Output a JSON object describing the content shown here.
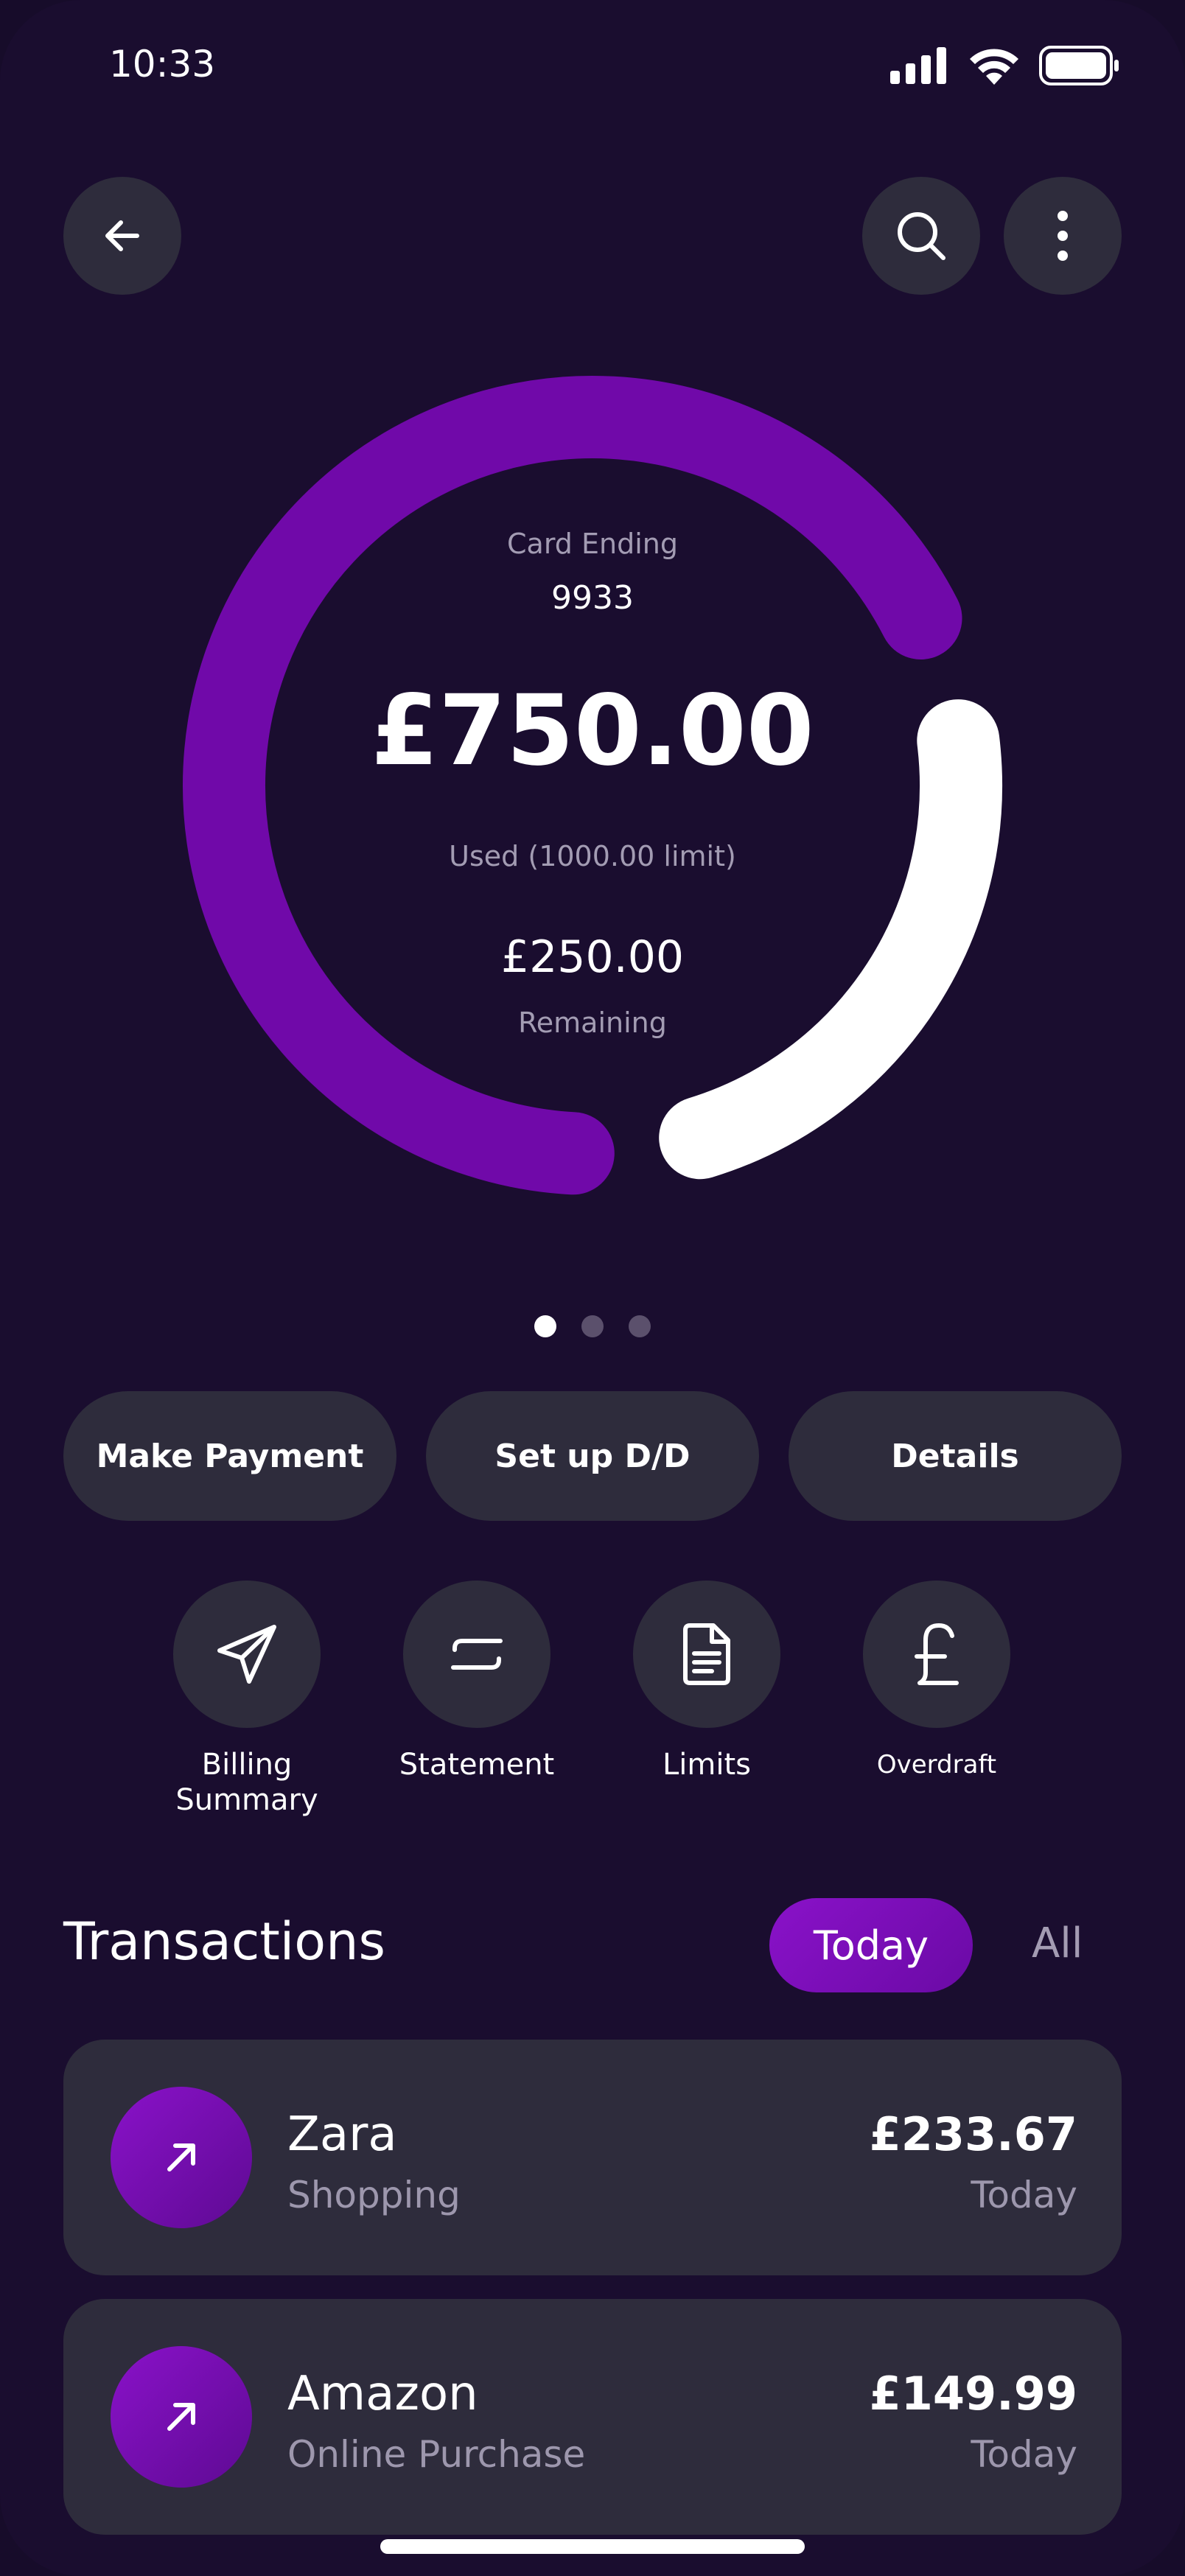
{
  "status_bar": {
    "time": "10:33"
  },
  "card": {
    "ending_label": "Card Ending",
    "ending_number": "9933",
    "used_amount": "£750.00",
    "used_label": "Used (1000.00 limit)",
    "remaining_amount": "£250.00",
    "remaining_label": "Remaining",
    "used_fraction": 0.75,
    "colors": {
      "used": "#7009a9",
      "remaining": "#ffffff"
    }
  },
  "pager": {
    "pages": 3,
    "active": 0
  },
  "actions": {
    "make_payment": "Make Payment",
    "setup_dd": "Set up D/D",
    "details": "Details"
  },
  "quick_actions": [
    {
      "label": "Billing\nSummary",
      "icon": "send-icon"
    },
    {
      "label": "Statement",
      "icon": "statement-icon"
    },
    {
      "label": "Limits",
      "icon": "document-icon"
    },
    {
      "label": "Overdraft",
      "icon": "pound-icon"
    }
  ],
  "transactions": {
    "title": "Transactions",
    "tabs": {
      "today": "Today",
      "all": "All"
    },
    "items": [
      {
        "name": "Zara",
        "category": "Shopping",
        "amount": "£233.67",
        "date": "Today",
        "icon": "arrow-up-right-icon"
      },
      {
        "name": "Amazon",
        "category": "Online Purchase",
        "amount": "£149.99",
        "date": "Today",
        "icon": "arrow-up-right-icon"
      }
    ]
  },
  "theme": {
    "background": "#1a0d2f",
    "surface": "#2e2c3c",
    "accent": "#7009a9"
  }
}
